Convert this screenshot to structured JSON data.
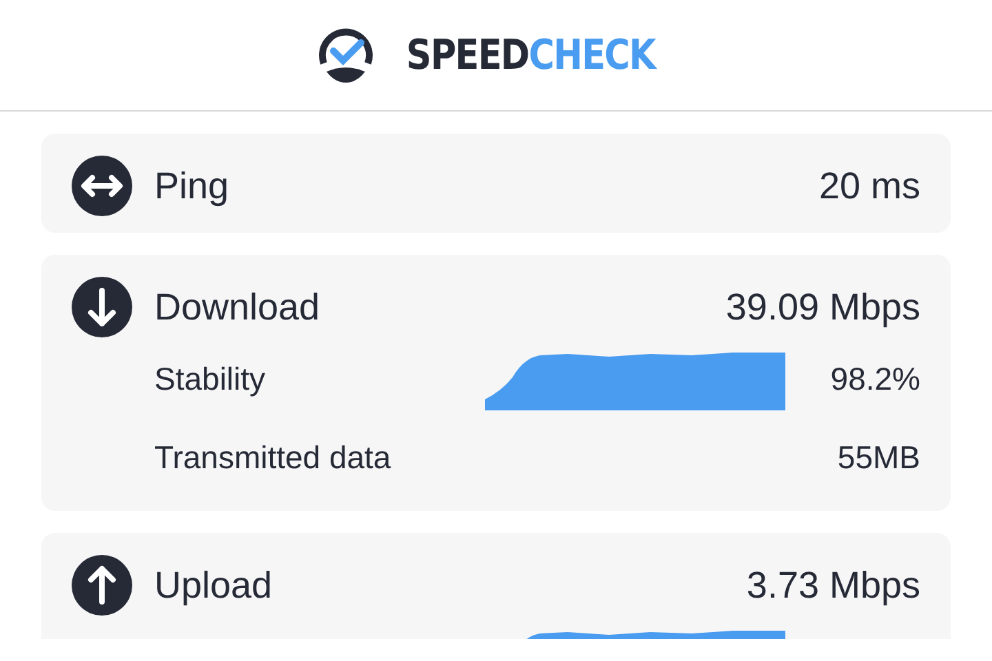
{
  "logo": {
    "primary": "SPEED",
    "accent": "CHECK"
  },
  "metrics": [
    {
      "kind": "ping",
      "label": "Ping",
      "value": "20 ms"
    },
    {
      "kind": "download",
      "label": "Download",
      "value": "39.09 Mbps",
      "details": [
        {
          "kind": "stability",
          "label": "Stability",
          "value": "98.2%"
        },
        {
          "kind": "data",
          "label": "Transmitted data",
          "value": "55MB"
        }
      ]
    },
    {
      "kind": "upload",
      "label": "Upload",
      "value": "3.73 Mbps",
      "details": [
        {
          "kind": "stability"
        }
      ]
    }
  ]
}
